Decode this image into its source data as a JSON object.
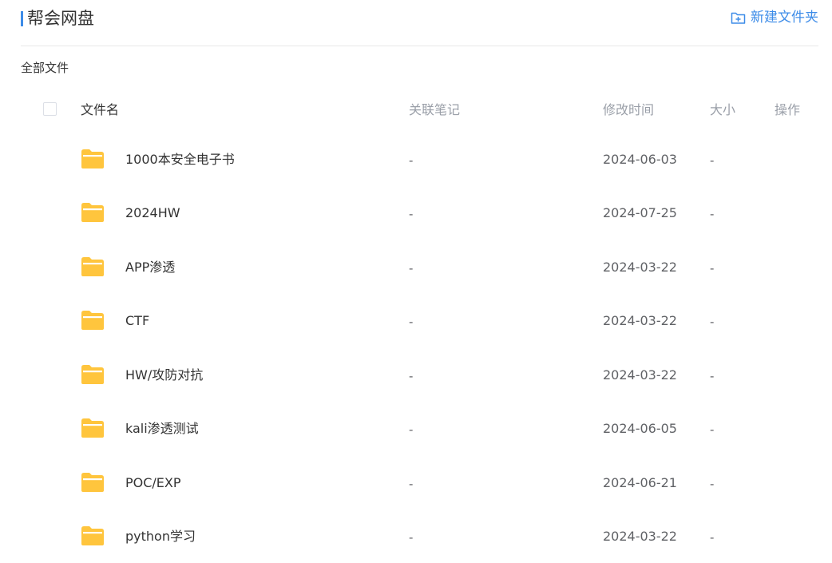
{
  "header": {
    "title": "帮会网盘",
    "new_folder_label": "新建文件夹"
  },
  "breadcrumb": "全部文件",
  "table": {
    "columns": {
      "name": "文件名",
      "note": "关联笔记",
      "time": "修改时间",
      "size": "大小",
      "op": "操作"
    },
    "rows": [
      {
        "name": "1000本安全电子书",
        "note": "-",
        "time": "2024-06-03",
        "size": "-"
      },
      {
        "name": "2024HW",
        "note": "-",
        "time": "2024-07-25",
        "size": "-"
      },
      {
        "name": "APP渗透",
        "note": "-",
        "time": "2024-03-22",
        "size": "-"
      },
      {
        "name": "CTF",
        "note": "-",
        "time": "2024-03-22",
        "size": "-"
      },
      {
        "name": "HW/攻防对抗",
        "note": "-",
        "time": "2024-03-22",
        "size": "-"
      },
      {
        "name": "kali渗透测试",
        "note": "-",
        "time": "2024-06-05",
        "size": "-"
      },
      {
        "name": "POC/EXP",
        "note": "-",
        "time": "2024-06-21",
        "size": "-"
      },
      {
        "name": "python学习",
        "note": "-",
        "time": "2024-03-22",
        "size": "-"
      }
    ]
  },
  "icons": {
    "folder": "folder-icon",
    "new_folder": "folder-plus-icon"
  },
  "colors": {
    "accent": "#3d8ce8",
    "folder": "#ffc53d",
    "muted_text": "#9a9fa8"
  }
}
